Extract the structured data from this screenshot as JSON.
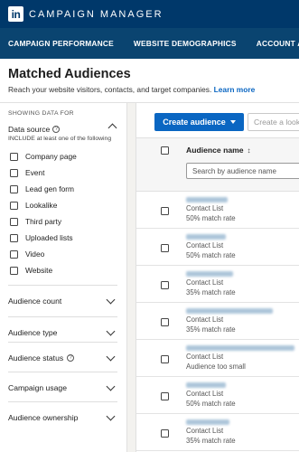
{
  "topbar": {
    "logo_text": "in",
    "brand": "CAMPAIGN MANAGER"
  },
  "nav": [
    "CAMPAIGN PERFORMANCE",
    "WEBSITE DEMOGRAPHICS",
    "ACCOUNT ASSETS"
  ],
  "header": {
    "title": "Matched Audiences",
    "subtitle": "Reach your website visitors, contacts, and target companies.",
    "learn_more": "Learn more"
  },
  "sidebar": {
    "heading": "SHOWING DATA FOR",
    "data_source": {
      "title": "Data source",
      "help": "?",
      "subtitle": "INCLUDE at least one of the following",
      "options": [
        "Company page",
        "Event",
        "Lead gen form",
        "Lookalike",
        "Third party",
        "Uploaded lists",
        "Video",
        "Website"
      ]
    },
    "filters": [
      {
        "label": "Audience count",
        "help": false
      },
      {
        "label": "Audience type",
        "help": false
      },
      {
        "label": "Audience status",
        "help": true
      },
      {
        "label": "Campaign usage",
        "help": false
      },
      {
        "label": "Audience ownership",
        "help": false
      }
    ]
  },
  "main": {
    "create_label": "Create audience",
    "secondary_label": "Create a look",
    "table": {
      "column_name": "Audience name",
      "sort_icon": "↕",
      "search_placeholder": "Search by audience name",
      "rows": [
        {
          "type": "Contact List",
          "status": "50% match rate"
        },
        {
          "type": "Contact List",
          "status": "50% match rate"
        },
        {
          "type": "Contact List",
          "status": "35% match rate"
        },
        {
          "type": "Contact List",
          "status": "35% match rate"
        },
        {
          "type": "Contact List",
          "status": "Audience too small"
        },
        {
          "type": "Contact List",
          "status": "50% match rate"
        },
        {
          "type": "Contact List",
          "status": "35% match rate"
        }
      ]
    }
  },
  "colors": {
    "topbar": "#00386a",
    "nav": "#0a4470",
    "primary": "#0a66c2"
  }
}
